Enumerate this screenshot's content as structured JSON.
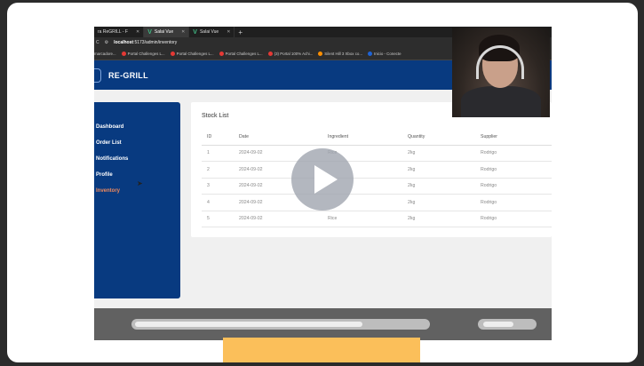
{
  "browser": {
    "tabs": [
      {
        "label": "ra ReGRILL - F",
        "active": false
      },
      {
        "label": "Salai Vue",
        "active": true
      },
      {
        "label": "Salai Vue",
        "active": false
      }
    ],
    "new_tab": "+",
    "url_host": "localhost",
    "url_path": ":5173/admin/inventory",
    "bookmarks": [
      {
        "label": "marcadore...",
        "icon": "folder"
      },
      {
        "label": "Portal Challenges L...",
        "icon": "red-circle"
      },
      {
        "label": "Portal Challenges L...",
        "icon": "red-circle"
      },
      {
        "label": "Portal Challenges L...",
        "icon": "red-circle"
      },
      {
        "label": "(3) Portal 100% Achi...",
        "icon": "red-circle"
      },
      {
        "label": "Silent Hill 3 Xbox co...",
        "icon": "orange-circle"
      },
      {
        "label": "Inicio - Conecte",
        "icon": "blue-circle"
      }
    ]
  },
  "app": {
    "brand": "RE-GRILL",
    "sidebar": [
      {
        "label": "Dashboard",
        "active": false
      },
      {
        "label": "Order List",
        "active": false
      },
      {
        "label": "Notifications",
        "active": false
      },
      {
        "label": "Profile",
        "active": false
      },
      {
        "label": "Inventory",
        "active": true
      }
    ],
    "stock": {
      "title": "Stock List",
      "columns": [
        "ID",
        "Date",
        "Ingredient",
        "Quantity",
        "Supplier"
      ],
      "rows": [
        [
          "1",
          "2024-09-02",
          "Rice",
          "2kg",
          "Rodrigo"
        ],
        [
          "2",
          "2024-09-02",
          "",
          "2kg",
          "Rodrigo"
        ],
        [
          "3",
          "2024-09-02",
          "",
          "2kg",
          "Rodrigo"
        ],
        [
          "4",
          "2024-09-02",
          "",
          "2kg",
          "Rodrigo"
        ],
        [
          "5",
          "2024-09-02",
          "Rice",
          "2kg",
          "Rodrigo"
        ]
      ]
    }
  },
  "colors": {
    "nav_blue": "#083a80",
    "active_item": "#f08a5d",
    "bottom_bar": "#fbbf5a",
    "scroll_track": "#616161"
  }
}
